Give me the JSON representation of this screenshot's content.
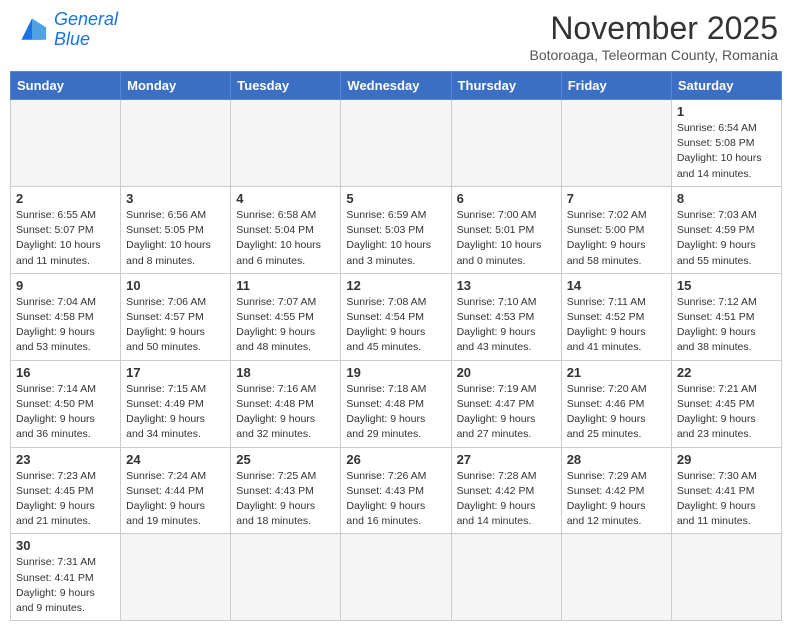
{
  "logo": {
    "line1": "General",
    "line2": "Blue"
  },
  "title": "November 2025",
  "subtitle": "Botoroaga, Teleorman County, Romania",
  "weekdays": [
    "Sunday",
    "Monday",
    "Tuesday",
    "Wednesday",
    "Thursday",
    "Friday",
    "Saturday"
  ],
  "weeks": [
    [
      {
        "day": "",
        "info": ""
      },
      {
        "day": "",
        "info": ""
      },
      {
        "day": "",
        "info": ""
      },
      {
        "day": "",
        "info": ""
      },
      {
        "day": "",
        "info": ""
      },
      {
        "day": "",
        "info": ""
      },
      {
        "day": "1",
        "info": "Sunrise: 6:54 AM\nSunset: 5:08 PM\nDaylight: 10 hours\nand 14 minutes."
      }
    ],
    [
      {
        "day": "2",
        "info": "Sunrise: 6:55 AM\nSunset: 5:07 PM\nDaylight: 10 hours\nand 11 minutes."
      },
      {
        "day": "3",
        "info": "Sunrise: 6:56 AM\nSunset: 5:05 PM\nDaylight: 10 hours\nand 8 minutes."
      },
      {
        "day": "4",
        "info": "Sunrise: 6:58 AM\nSunset: 5:04 PM\nDaylight: 10 hours\nand 6 minutes."
      },
      {
        "day": "5",
        "info": "Sunrise: 6:59 AM\nSunset: 5:03 PM\nDaylight: 10 hours\nand 3 minutes."
      },
      {
        "day": "6",
        "info": "Sunrise: 7:00 AM\nSunset: 5:01 PM\nDaylight: 10 hours\nand 0 minutes."
      },
      {
        "day": "7",
        "info": "Sunrise: 7:02 AM\nSunset: 5:00 PM\nDaylight: 9 hours\nand 58 minutes."
      },
      {
        "day": "8",
        "info": "Sunrise: 7:03 AM\nSunset: 4:59 PM\nDaylight: 9 hours\nand 55 minutes."
      }
    ],
    [
      {
        "day": "9",
        "info": "Sunrise: 7:04 AM\nSunset: 4:58 PM\nDaylight: 9 hours\nand 53 minutes."
      },
      {
        "day": "10",
        "info": "Sunrise: 7:06 AM\nSunset: 4:57 PM\nDaylight: 9 hours\nand 50 minutes."
      },
      {
        "day": "11",
        "info": "Sunrise: 7:07 AM\nSunset: 4:55 PM\nDaylight: 9 hours\nand 48 minutes."
      },
      {
        "day": "12",
        "info": "Sunrise: 7:08 AM\nSunset: 4:54 PM\nDaylight: 9 hours\nand 45 minutes."
      },
      {
        "day": "13",
        "info": "Sunrise: 7:10 AM\nSunset: 4:53 PM\nDaylight: 9 hours\nand 43 minutes."
      },
      {
        "day": "14",
        "info": "Sunrise: 7:11 AM\nSunset: 4:52 PM\nDaylight: 9 hours\nand 41 minutes."
      },
      {
        "day": "15",
        "info": "Sunrise: 7:12 AM\nSunset: 4:51 PM\nDaylight: 9 hours\nand 38 minutes."
      }
    ],
    [
      {
        "day": "16",
        "info": "Sunrise: 7:14 AM\nSunset: 4:50 PM\nDaylight: 9 hours\nand 36 minutes."
      },
      {
        "day": "17",
        "info": "Sunrise: 7:15 AM\nSunset: 4:49 PM\nDaylight: 9 hours\nand 34 minutes."
      },
      {
        "day": "18",
        "info": "Sunrise: 7:16 AM\nSunset: 4:48 PM\nDaylight: 9 hours\nand 32 minutes."
      },
      {
        "day": "19",
        "info": "Sunrise: 7:18 AM\nSunset: 4:48 PM\nDaylight: 9 hours\nand 29 minutes."
      },
      {
        "day": "20",
        "info": "Sunrise: 7:19 AM\nSunset: 4:47 PM\nDaylight: 9 hours\nand 27 minutes."
      },
      {
        "day": "21",
        "info": "Sunrise: 7:20 AM\nSunset: 4:46 PM\nDaylight: 9 hours\nand 25 minutes."
      },
      {
        "day": "22",
        "info": "Sunrise: 7:21 AM\nSunset: 4:45 PM\nDaylight: 9 hours\nand 23 minutes."
      }
    ],
    [
      {
        "day": "23",
        "info": "Sunrise: 7:23 AM\nSunset: 4:45 PM\nDaylight: 9 hours\nand 21 minutes."
      },
      {
        "day": "24",
        "info": "Sunrise: 7:24 AM\nSunset: 4:44 PM\nDaylight: 9 hours\nand 19 minutes."
      },
      {
        "day": "25",
        "info": "Sunrise: 7:25 AM\nSunset: 4:43 PM\nDaylight: 9 hours\nand 18 minutes."
      },
      {
        "day": "26",
        "info": "Sunrise: 7:26 AM\nSunset: 4:43 PM\nDaylight: 9 hours\nand 16 minutes."
      },
      {
        "day": "27",
        "info": "Sunrise: 7:28 AM\nSunset: 4:42 PM\nDaylight: 9 hours\nand 14 minutes."
      },
      {
        "day": "28",
        "info": "Sunrise: 7:29 AM\nSunset: 4:42 PM\nDaylight: 9 hours\nand 12 minutes."
      },
      {
        "day": "29",
        "info": "Sunrise: 7:30 AM\nSunset: 4:41 PM\nDaylight: 9 hours\nand 11 minutes."
      }
    ],
    [
      {
        "day": "30",
        "info": "Sunrise: 7:31 AM\nSunset: 4:41 PM\nDaylight: 9 hours\nand 9 minutes."
      },
      {
        "day": "",
        "info": ""
      },
      {
        "day": "",
        "info": ""
      },
      {
        "day": "",
        "info": ""
      },
      {
        "day": "",
        "info": ""
      },
      {
        "day": "",
        "info": ""
      },
      {
        "day": "",
        "info": ""
      }
    ]
  ]
}
